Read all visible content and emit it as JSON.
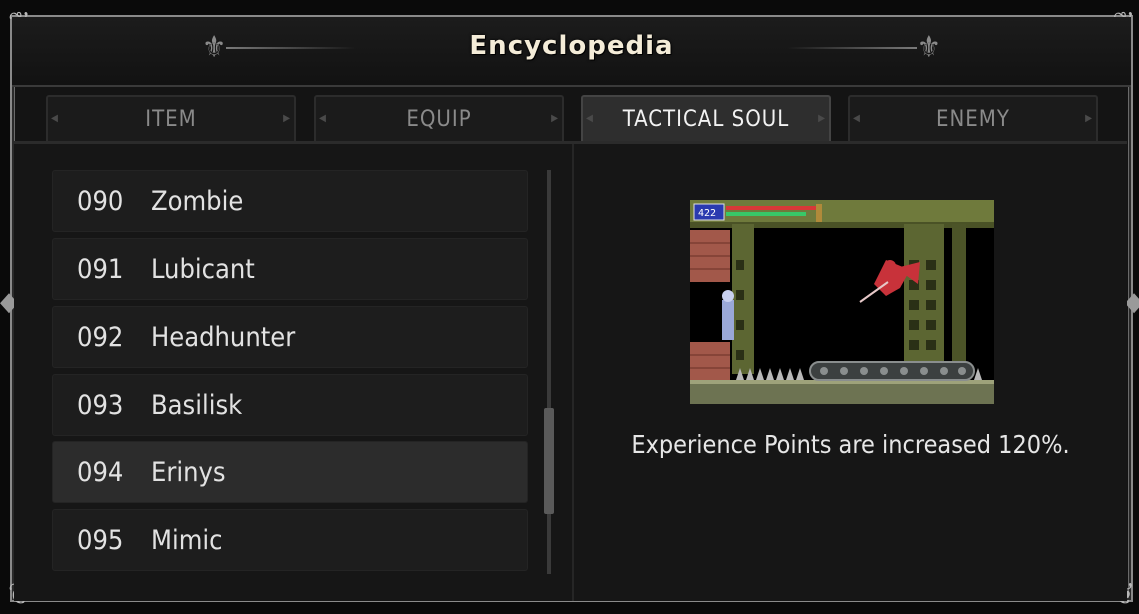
{
  "header": {
    "title": "Encyclopedia"
  },
  "tabs": [
    {
      "label": "ITEM"
    },
    {
      "label": "EQUIP"
    },
    {
      "label": "TACTICAL SOUL"
    },
    {
      "label": "ENEMY"
    }
  ],
  "active_tab": "TACTICAL SOUL",
  "list": {
    "items": [
      {
        "num": "090",
        "name": "Zombie"
      },
      {
        "num": "091",
        "name": "Lubicant"
      },
      {
        "num": "092",
        "name": "Headhunter"
      },
      {
        "num": "093",
        "name": "Basilisk"
      },
      {
        "num": "094",
        "name": "Erinys"
      },
      {
        "num": "095",
        "name": "Mimic"
      }
    ],
    "selected_index": 4
  },
  "detail": {
    "hud_value": "422",
    "description": "Experience Points are increased 120%."
  },
  "colors": {
    "frame": "#8a8a8a",
    "background": "#141414",
    "active_tab": "#2e2e2e",
    "selected_row": "#2c2c2c"
  }
}
